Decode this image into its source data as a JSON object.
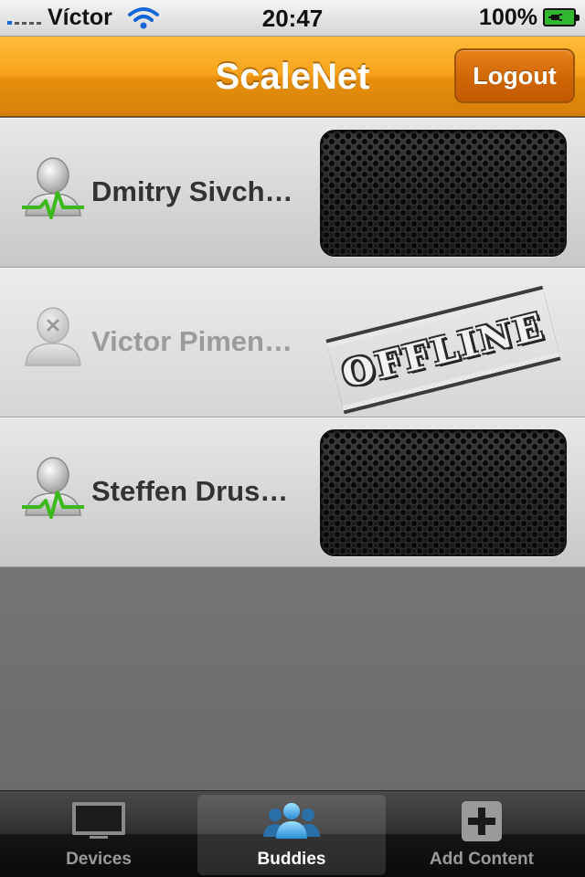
{
  "status_bar": {
    "carrier": "Víctor",
    "time": "20:47",
    "battery": "100%"
  },
  "nav": {
    "title": "ScaleNet",
    "logout_label": "Logout"
  },
  "buddies": [
    {
      "name": "Dmitry Sivch…",
      "status": "online"
    },
    {
      "name": "Victor Pimen…",
      "status": "offline",
      "stamp": "OFFLINE"
    },
    {
      "name": "Steffen Drus…",
      "status": "online"
    }
  ],
  "tabs": [
    {
      "label": "Devices",
      "icon": "monitor-icon",
      "active": false
    },
    {
      "label": "Buddies",
      "icon": "buddies-icon",
      "active": true
    },
    {
      "label": "Add Content",
      "icon": "plus-icon",
      "active": false
    }
  ],
  "colors": {
    "nav_orange": "#f7a21a",
    "logout_orange": "#cf6605",
    "online_green": "#3db81a",
    "active_tab_blue": "#3aa7e8"
  }
}
